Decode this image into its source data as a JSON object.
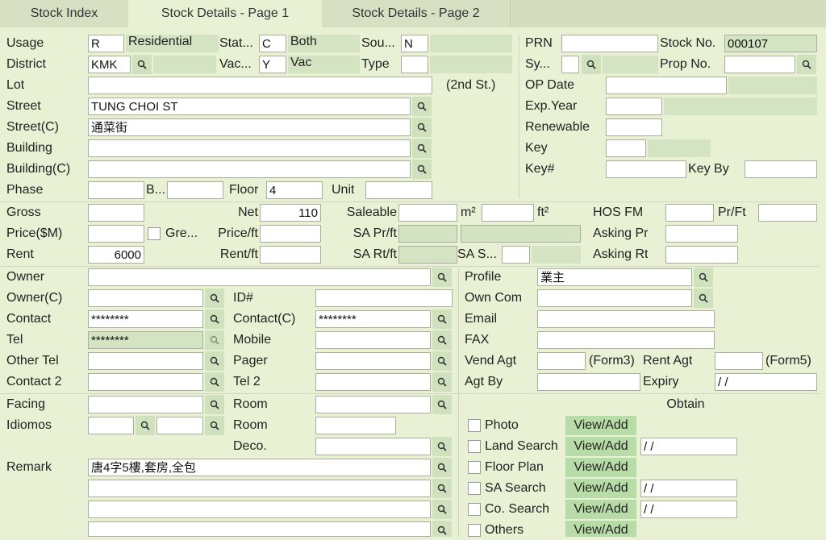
{
  "tabs": [
    "Stock Index",
    "Stock Details - Page 1",
    "Stock Details - Page 2"
  ],
  "usage": {
    "label": "Usage",
    "value": "R",
    "desc": "Residential"
  },
  "status": {
    "label": "Stat...",
    "value": "C",
    "desc": "Both"
  },
  "source": {
    "label": "Sou...",
    "value": "N"
  },
  "district": {
    "label": "District",
    "value": "KMK"
  },
  "vacant": {
    "label": "Vac...",
    "value": "Y",
    "desc": "Vac"
  },
  "type": {
    "label": "Type",
    "value": ""
  },
  "lot": {
    "label": "Lot",
    "value": "",
    "note": "(2nd St.)"
  },
  "street": {
    "label": "Street",
    "value": "TUNG CHOI ST"
  },
  "street_c": {
    "label": "Street(C)",
    "value": "通菜街"
  },
  "building": {
    "label": "Building",
    "value": ""
  },
  "building_c": {
    "label": "Building(C)",
    "value": ""
  },
  "phase": {
    "label": "Phase",
    "value": ""
  },
  "block": {
    "label": "B...",
    "value": ""
  },
  "floor": {
    "label": "Floor",
    "value": "4"
  },
  "unit": {
    "label": "Unit",
    "value": ""
  },
  "prn": {
    "label": "PRN",
    "value": ""
  },
  "stock_no": {
    "label": "Stock No.",
    "value": "000107"
  },
  "sy": {
    "label": "Sy...",
    "value": ""
  },
  "prop_no": {
    "label": "Prop No.",
    "value": ""
  },
  "op_date": {
    "label": "OP Date",
    "value": ""
  },
  "exp_year": {
    "label": "Exp.Year",
    "value": ""
  },
  "renewable": {
    "label": "Renewable",
    "value": ""
  },
  "key": {
    "label": "Key",
    "value": ""
  },
  "key_no": {
    "label": "Key#",
    "value": ""
  },
  "key_by": {
    "label": "Key By",
    "value": ""
  },
  "gross": {
    "label": "Gross",
    "value": ""
  },
  "net": {
    "label": "Net",
    "value": "110"
  },
  "saleable": {
    "label": "Saleable",
    "value": "",
    "m2": "m²",
    "ft2": "ft²"
  },
  "hos_fm": {
    "label": "HOS FM",
    "value": ""
  },
  "pr_ft_top": {
    "label": "Pr/Ft",
    "value": ""
  },
  "price": {
    "label": "Price($M)",
    "value": "",
    "gre": "Gre..."
  },
  "price_ft": {
    "label": "Price/ft",
    "value": ""
  },
  "sa_pr_ft": {
    "label": "SA Pr/ft",
    "value": ""
  },
  "asking_pr": {
    "label": "Asking Pr",
    "value": ""
  },
  "rent": {
    "label": "Rent",
    "value": "6000"
  },
  "rent_ft": {
    "label": "Rent/ft",
    "value": ""
  },
  "sa_rt_ft": {
    "label": "SA Rt/ft",
    "value": ""
  },
  "sa_s": {
    "label": "SA S...",
    "value": ""
  },
  "asking_rt": {
    "label": "Asking Rt",
    "value": ""
  },
  "owner": {
    "label": "Owner",
    "value": ""
  },
  "owner_c": {
    "label": "Owner(C)",
    "value": ""
  },
  "id_no": {
    "label": "ID#",
    "value": ""
  },
  "contact": {
    "label": "Contact",
    "value": "********"
  },
  "contact_c": {
    "label": "Contact(C)",
    "value": "********"
  },
  "tel": {
    "label": "Tel",
    "value": "********"
  },
  "mobile": {
    "label": "Mobile",
    "value": ""
  },
  "other_tel": {
    "label": "Other Tel",
    "value": ""
  },
  "pager": {
    "label": "Pager",
    "value": ""
  },
  "contact2": {
    "label": "Contact 2",
    "value": ""
  },
  "tel2": {
    "label": "Tel 2",
    "value": ""
  },
  "profile": {
    "label": "Profile",
    "value": "業主"
  },
  "own_com": {
    "label": "Own Com",
    "value": ""
  },
  "email": {
    "label": "Email",
    "value": ""
  },
  "fax": {
    "label": "FAX",
    "value": ""
  },
  "vend_agt": {
    "label": "Vend Agt",
    "value": "",
    "form3": "(Form3)"
  },
  "rent_agt": {
    "label": "Rent Agt",
    "value": "",
    "form5": "(Form5)"
  },
  "agt_by": {
    "label": "Agt By",
    "value": ""
  },
  "expiry": {
    "label": "Expiry",
    "value": " / /"
  },
  "facing": {
    "label": "Facing",
    "value": ""
  },
  "room1": {
    "label": "Room",
    "value": ""
  },
  "idiomos": {
    "label": "Idiomos",
    "value1": "",
    "value2": ""
  },
  "room2": {
    "label": "Room",
    "value": ""
  },
  "deco": {
    "label": "Deco.",
    "value": ""
  },
  "remark": {
    "label": "Remark",
    "lines": [
      "唐4字5樓,套房,全包",
      "",
      "",
      ""
    ]
  },
  "obtain": {
    "title": "Obtain",
    "button_label": "View/Add",
    "items": [
      {
        "label": "Photo",
        "date": null
      },
      {
        "label": "Land Search",
        "date": " / /"
      },
      {
        "label": "Floor Plan",
        "date": null
      },
      {
        "label": "SA Search",
        "date": " / /"
      },
      {
        "label": "Co. Search",
        "date": " / /"
      },
      {
        "label": "Others",
        "date": null
      }
    ]
  },
  "colors": {
    "background": "#e8f1d4",
    "readonly": "#d4e4c2",
    "button": "#b8dca7"
  }
}
